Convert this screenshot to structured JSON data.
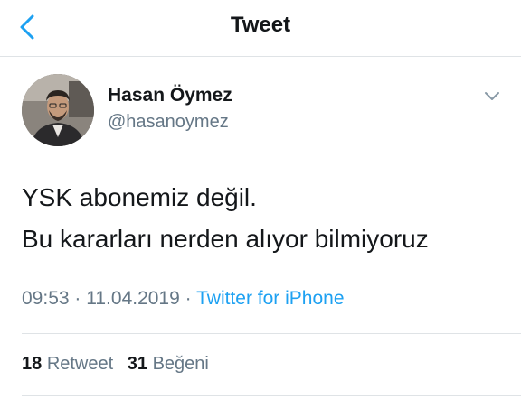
{
  "header": {
    "title": "Tweet",
    "back_icon": "chevron-left-icon"
  },
  "author": {
    "name": "Hasan Öymez",
    "handle": "@hasanoymez"
  },
  "tweet": {
    "lines": [
      "YSK abonemiz değil.",
      "Bu kararları nerden alıyor bilmiyoruz"
    ]
  },
  "meta": {
    "time": "09:53",
    "separator": "·",
    "date": "11.04.2019",
    "source": "Twitter for iPhone"
  },
  "stats": {
    "retweet_count": "18",
    "retweet_label": "Retweet",
    "like_count": "31",
    "like_label": "Beğeni"
  },
  "colors": {
    "accent": "#1da1f2",
    "secondary_text": "#657786",
    "primary_text": "#14171a"
  }
}
